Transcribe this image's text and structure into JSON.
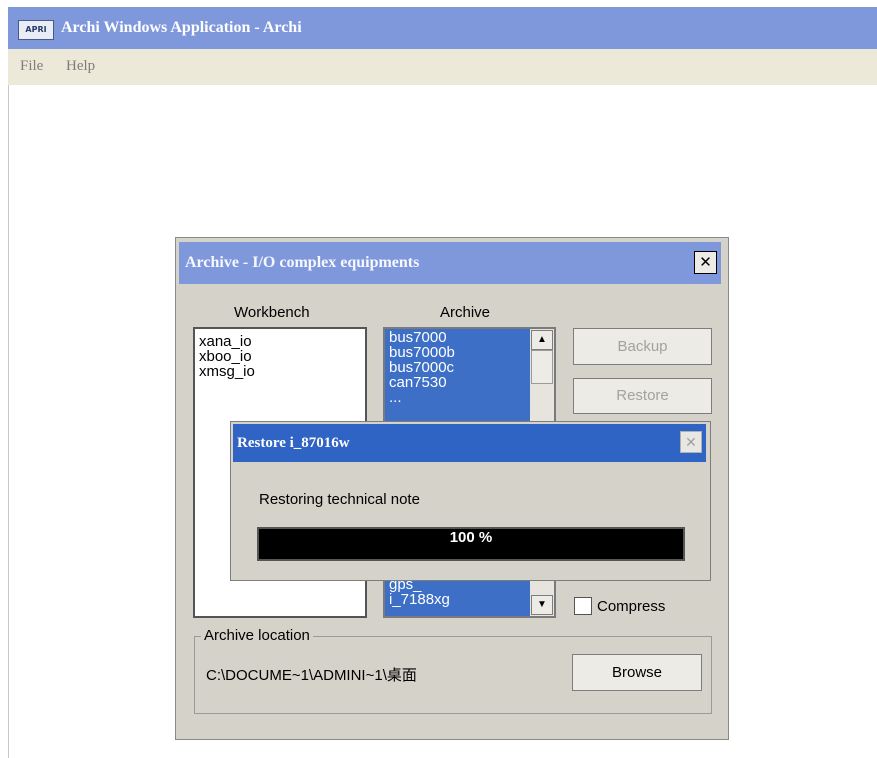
{
  "app": {
    "title": "Archi Windows Application - Archi",
    "icon": "archi-app-icon",
    "menu": [
      "File",
      "Help"
    ]
  },
  "archive_dialog": {
    "title": "Archive - I/O complex equipments",
    "workbench_label": "Workbench",
    "archive_label": "Archive",
    "workbench_items": [
      "xana_io",
      "xboo_io",
      "xmsg_io"
    ],
    "archive_items_top": [
      "bus7000",
      "bus7000b",
      "bus7000c",
      "can7530",
      "..."
    ],
    "archive_items_bottom": [
      "gps_",
      "i_7188xg"
    ],
    "backup_label": "Backup",
    "restore_label": "Restore",
    "compress_label": "Compress",
    "compress_checked": false,
    "location_group": "Archive location",
    "location_path": "C:\\DOCUME~1\\ADMINI~1\\桌面",
    "browse_label": "Browse"
  },
  "progress_dialog": {
    "title": "Restore i_87016w",
    "message": "Restoring technical note",
    "percent_text": "100 %",
    "progress_fraction": 1.0
  }
}
